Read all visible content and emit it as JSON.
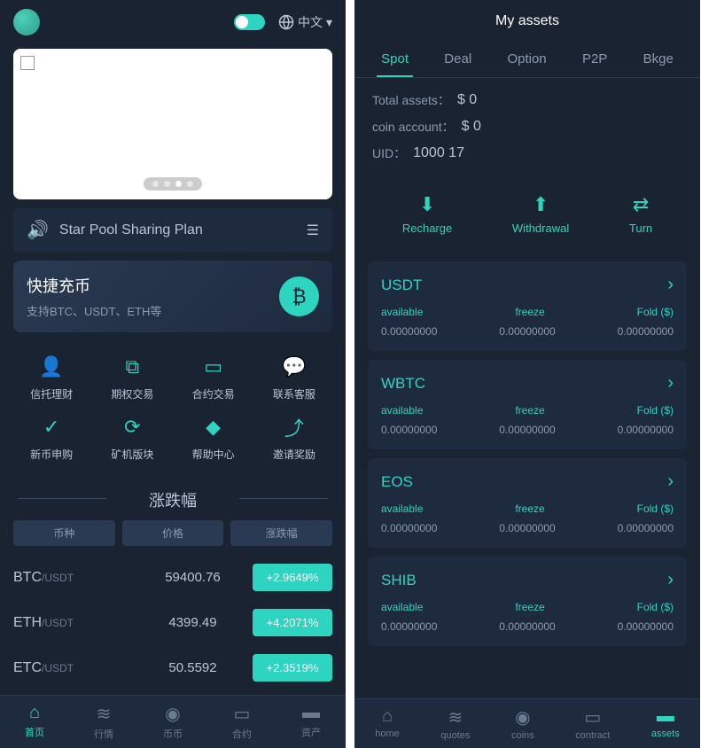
{
  "left": {
    "language": "中文",
    "announce_text": "Star Pool Sharing Plan",
    "deposit": {
      "title": "快捷充币",
      "subtitle": "支持BTC、USDT、ETH等"
    },
    "menu": [
      {
        "label": "信托理财"
      },
      {
        "label": "期权交易"
      },
      {
        "label": "合约交易"
      },
      {
        "label": "联系客服"
      },
      {
        "label": "新币申购"
      },
      {
        "label": "矿机版块"
      },
      {
        "label": "帮助中心"
      },
      {
        "label": "邀请奖励"
      }
    ],
    "section_title": "涨跌幅",
    "headers": [
      "币种",
      "价格",
      "涨跌幅"
    ],
    "rows": [
      {
        "sym": "BTC",
        "pair": "/USDT",
        "price": "59400.76",
        "change": "+2.9649%"
      },
      {
        "sym": "ETH",
        "pair": "/USDT",
        "price": "4399.49",
        "change": "+4.2071%"
      },
      {
        "sym": "ETC",
        "pair": "/USDT",
        "price": "50.5592",
        "change": "+2.3519%"
      }
    ],
    "nav": [
      {
        "label": "首页"
      },
      {
        "label": "行情"
      },
      {
        "label": "币币"
      },
      {
        "label": "合约"
      },
      {
        "label": "资产"
      }
    ]
  },
  "right": {
    "title": "My assets",
    "tabs": [
      "Spot",
      "Deal",
      "Option",
      "P2P",
      "Bkge"
    ],
    "total_label": "Total assets：",
    "total_value": "$ 0",
    "account_label": "coin account：",
    "account_value": "$ 0",
    "uid_label": "UID：",
    "uid_value": "1000 17",
    "actions": [
      {
        "label": "Recharge"
      },
      {
        "label": "Withdrawal"
      },
      {
        "label": "Turn"
      }
    ],
    "col_labels": {
      "available": "available",
      "freeze": "freeze",
      "fold": "Fold ($)"
    },
    "coins": [
      {
        "sym": "USDT",
        "available": "0.00000000",
        "freeze": "0.00000000",
        "fold": "0.00000000"
      },
      {
        "sym": "WBTC",
        "available": "0.00000000",
        "freeze": "0.00000000",
        "fold": "0.00000000"
      },
      {
        "sym": "EOS",
        "available": "0.00000000",
        "freeze": "0.00000000",
        "fold": "0.00000000"
      },
      {
        "sym": "SHIB",
        "available": "0.00000000",
        "freeze": "0.00000000",
        "fold": "0.00000000"
      }
    ],
    "nav": [
      {
        "label": "home"
      },
      {
        "label": "quotes"
      },
      {
        "label": "coins"
      },
      {
        "label": "contract"
      },
      {
        "label": "assets"
      }
    ]
  }
}
